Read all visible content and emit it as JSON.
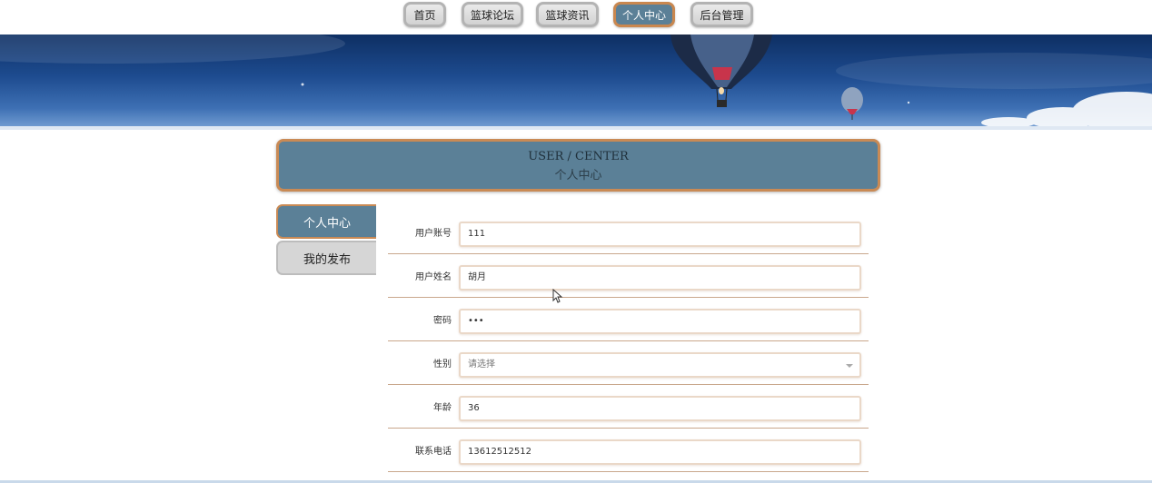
{
  "nav": {
    "items": [
      {
        "label": "首页",
        "active": false
      },
      {
        "label": "篮球论坛",
        "active": false
      },
      {
        "label": "篮球资讯",
        "active": false
      },
      {
        "label": "个人中心",
        "active": true
      },
      {
        "label": "后台管理",
        "active": false
      }
    ]
  },
  "header": {
    "title_en": "USER / CENTER",
    "title_cn": "个人中心"
  },
  "sidebar": {
    "items": [
      {
        "label": "个人中心",
        "active": true
      },
      {
        "label": "我的发布",
        "active": false
      }
    ]
  },
  "form": {
    "fields": [
      {
        "label": "用户账号",
        "value": "111"
      },
      {
        "label": "用户姓名",
        "value": "胡月"
      },
      {
        "label": "密码",
        "value": "•••"
      },
      {
        "label": "性别",
        "value": "",
        "placeholder": "请选择"
      },
      {
        "label": "年龄",
        "value": "36"
      },
      {
        "label": "联系电话",
        "value": "13612512512"
      }
    ]
  },
  "colors": {
    "accent": "#5b8097",
    "border_accent": "#c98a55"
  }
}
